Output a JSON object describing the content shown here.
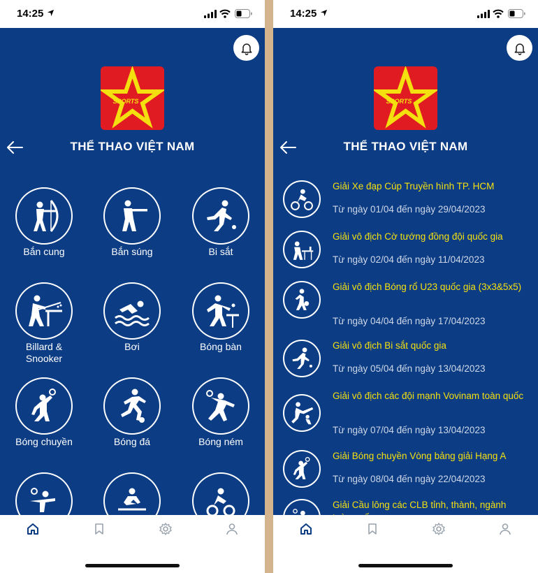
{
  "status": {
    "time": "14:25"
  },
  "header": {
    "title": "THỂ THAO VIỆT NAM",
    "logo_text": "SPORTS"
  },
  "sports": [
    {
      "label": "Bắn cung",
      "icon": "archery-icon"
    },
    {
      "label": "Bắn súng",
      "icon": "shooting-icon"
    },
    {
      "label": "Bi sắt",
      "icon": "petanque-icon"
    },
    {
      "label": "Billard &\nSnooker",
      "icon": "billiards-icon"
    },
    {
      "label": "Bơi",
      "icon": "swimming-icon"
    },
    {
      "label": "Bóng bàn",
      "icon": "table-tennis-icon"
    },
    {
      "label": "Bóng chuyền",
      "icon": "volleyball-icon"
    },
    {
      "label": "Bóng đá",
      "icon": "football-icon"
    },
    {
      "label": "Bóng ném",
      "icon": "handball-icon"
    },
    {
      "label": "",
      "icon": "badminton-icon"
    },
    {
      "label": "",
      "icon": "rowing-icon"
    },
    {
      "label": "",
      "icon": "cycling-icon"
    }
  ],
  "events": [
    {
      "title": "Giải Xe đạp Cúp Truyền hình TP. HCM",
      "date": "Từ ngày 01/04 đến ngày  29/04/2023",
      "icon": "cycling-icon"
    },
    {
      "title": "Giải vô địch Cờ tướng đồng đội quốc gia",
      "date": "Từ ngày 02/04 đến ngày  11/04/2023",
      "icon": "chess-icon"
    },
    {
      "title": "Giải vô địch Bóng rổ U23 quốc gia (3x3&5x5)",
      "date": "Từ ngày 04/04 đến ngày  17/04/2023",
      "icon": "basketball-icon"
    },
    {
      "title": "Giải vô địch Bi sắt quốc gia",
      "date": "Từ ngày 05/04 đến ngày  13/04/2023",
      "icon": "petanque-icon"
    },
    {
      "title": "Giải vô địch các đội mạnh Vovinam toàn quốc",
      "date": "Từ ngày 07/04 đến ngày  13/04/2023",
      "icon": "vovinam-icon"
    },
    {
      "title": "Giải Bóng chuyền Vòng bảng giải Hạng A",
      "date": "Từ ngày 08/04 đến ngày  22/04/2023",
      "icon": "volleyball-icon"
    },
    {
      "title": "Giải Cầu lông các CLB tỉnh, thành, ngành toàn quốc",
      "date": "",
      "icon": "badminton-icon"
    }
  ],
  "tabs": [
    "home-icon",
    "bookmark-icon",
    "settings-icon",
    "profile-icon"
  ],
  "colors": {
    "primary": "#0b3c84",
    "accent": "#f5e00f",
    "logo_bg": "#e11b22",
    "tab_active": "#0b3c84",
    "tab_inactive": "#9aa3ad"
  }
}
